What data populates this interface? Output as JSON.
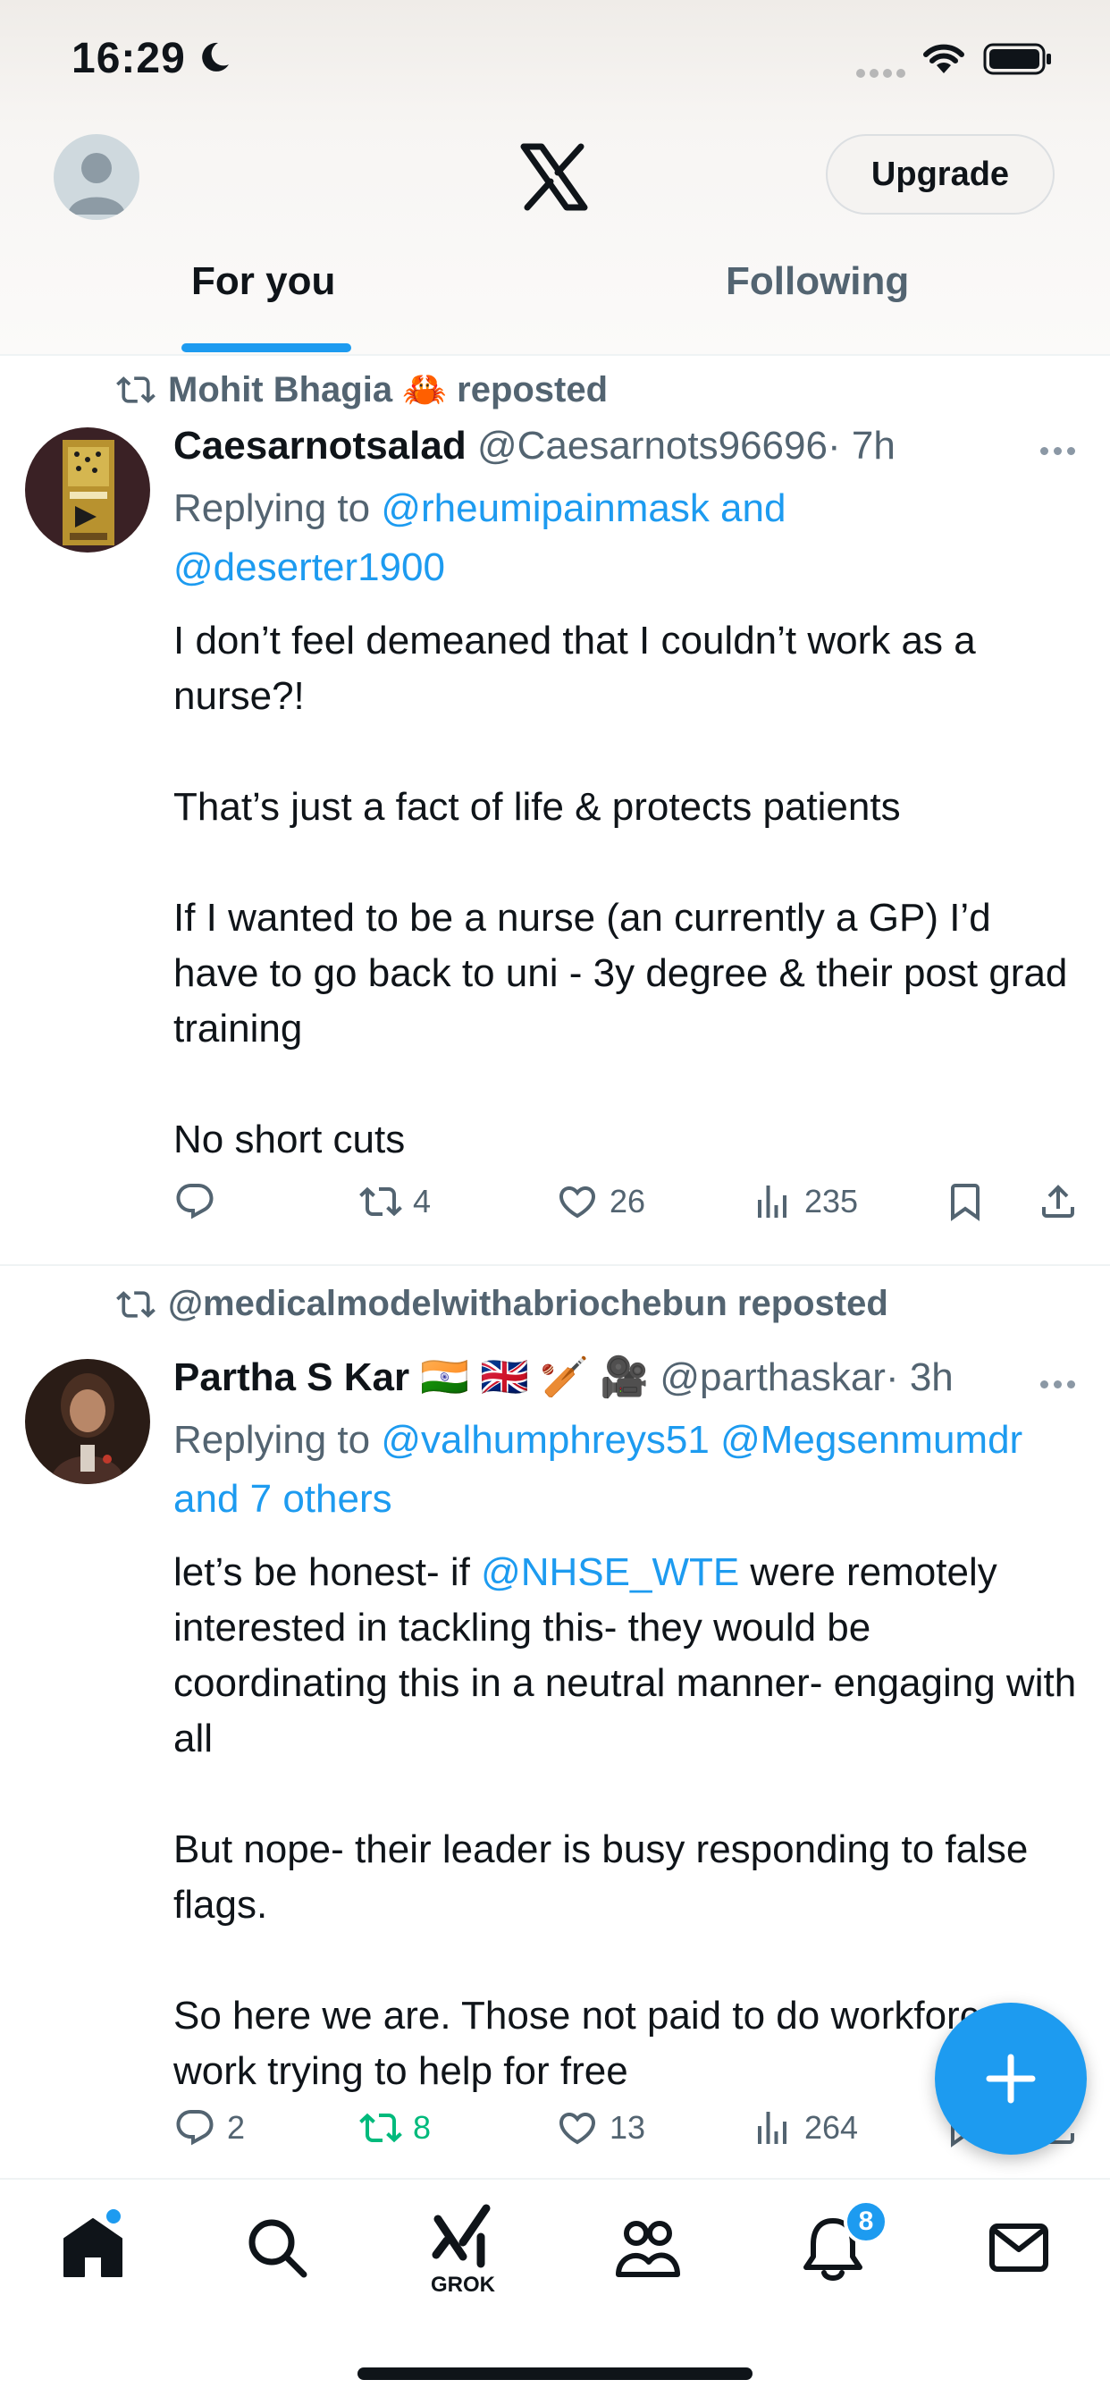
{
  "status_bar": {
    "time": "16:29"
  },
  "header": {
    "upgrade_label": "Upgrade"
  },
  "tabs": {
    "for_you": "For you",
    "following": "Following"
  },
  "tweets": [
    {
      "repost_by": "Mohit Bhagia 🦀 reposted",
      "name": "Caesarnotsalad",
      "handle": "@Caesarnots96696",
      "time": "· 7h",
      "replying_prefix": "Replying to ",
      "replying_to": "@rheumipainmask and",
      "replying_to_2": "@deserter1900",
      "body": "I don’t feel demeaned that I couldn’t work as a nurse?!\n\nThat’s just a fact of life & protects patients\n\nIf I wanted to be a nurse (an currently a GP) I’d have to go back to uni - 3y degree & their post grad training\n\nNo short cuts",
      "reply_count": "",
      "retweet_count": "4",
      "like_count": "26",
      "view_count": "235"
    },
    {
      "repost_by": "@medicalmodelwithabriochebun reposted",
      "name": "Partha S Kar 🇮🇳 🇬🇧 🏏 🎥",
      "handle": "@parthaskar",
      "time": "· 3h",
      "replying_prefix": "Replying to ",
      "replying_to": "@valhumphreys51 @Megsenmumdr",
      "replying_to_2": "and 7 others",
      "body_prefix": "let’s be honest- if ",
      "body_mention": "@NHSE_WTE",
      "body": " were remotely interested in tackling this- they would be coordinating this in a neutral manner- engaging with all\n\nBut nope- their leader is busy responding to false flags.\n\nSo here we are. Those not paid to do workforce work trying to help for free",
      "reply_count": "2",
      "retweet_count": "8",
      "like_count": "13",
      "view_count": "264"
    }
  ],
  "nav": {
    "grok_label": "GROK",
    "notifications_badge": "8"
  },
  "colors": {
    "accent": "#1d9bf0",
    "secondary_text": "#536471",
    "retweet_active": "#00ba7c"
  }
}
